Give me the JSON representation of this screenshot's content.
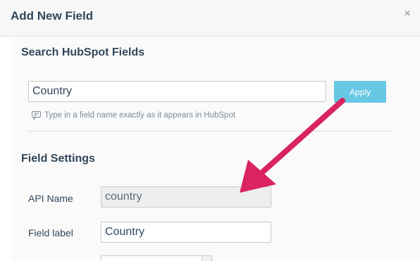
{
  "modal": {
    "title": "Add New Field",
    "close_glyph": "×"
  },
  "search": {
    "heading": "Search HubSpot Fields",
    "value": "Country",
    "placeholder": "",
    "apply_label": "Apply",
    "hint_icon": "comment-icon",
    "hint": "Type in a field name exactly as it appears in HubSpot"
  },
  "settings": {
    "heading": "Field Settings",
    "api_name_label": "API Name",
    "api_name_value": "country",
    "field_label_label": "Field label",
    "field_label_value": "Country"
  },
  "annotation": {
    "icon": "pointer-arrow-icon",
    "color": "#d9245f"
  },
  "colors": {
    "apply_button": "#68c8e4",
    "header_bg": "#f7f7f7",
    "text": "#33475b"
  }
}
